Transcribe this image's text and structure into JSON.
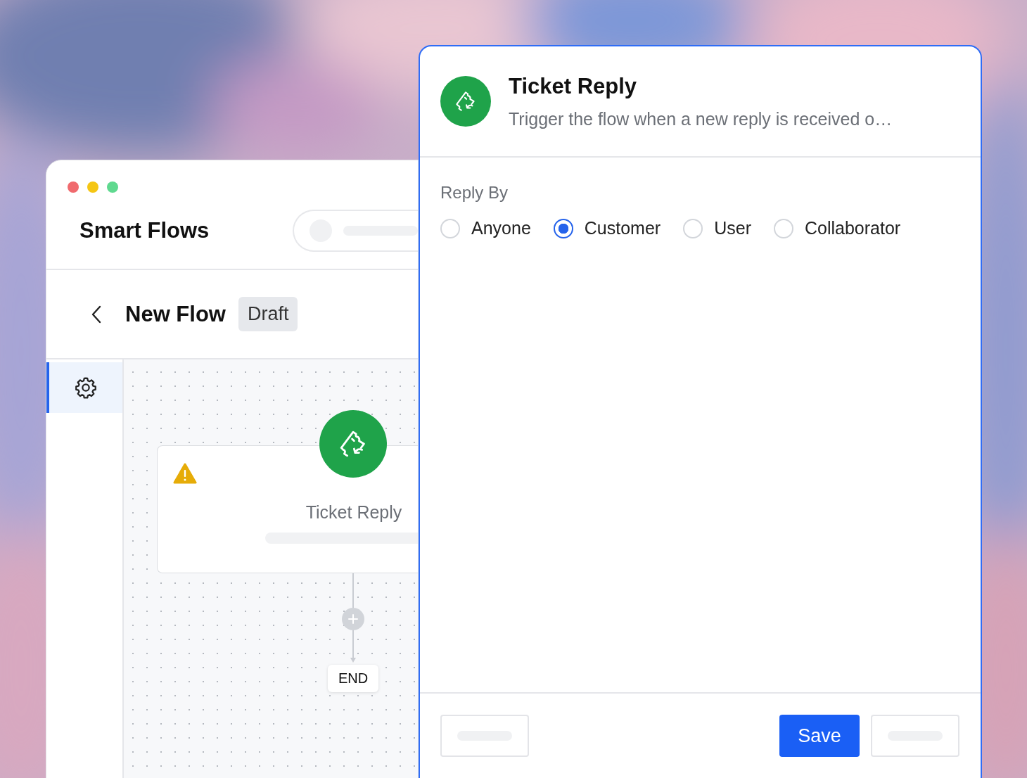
{
  "back_window": {
    "title": "Smart Flows",
    "flow_title": "New Flow",
    "status_badge": "Draft",
    "sidebar": [
      {
        "kind": "settings",
        "selected": true
      }
    ],
    "node": {
      "title": "Ticket Reply",
      "warning": true
    },
    "end_label": "END"
  },
  "panel": {
    "title": "Ticket Reply",
    "description": "Trigger the flow when a new reply is received o…",
    "field_label": "Reply By",
    "options": [
      {
        "label": "Anyone",
        "selected": false
      },
      {
        "label": "Customer",
        "selected": true
      },
      {
        "label": "User",
        "selected": false
      },
      {
        "label": "Collaborator",
        "selected": false
      }
    ],
    "footer_buttons": [
      {
        "kind": "skeleton"
      },
      {
        "kind": "primary",
        "label": "Save"
      },
      {
        "kind": "skeleton"
      }
    ]
  }
}
